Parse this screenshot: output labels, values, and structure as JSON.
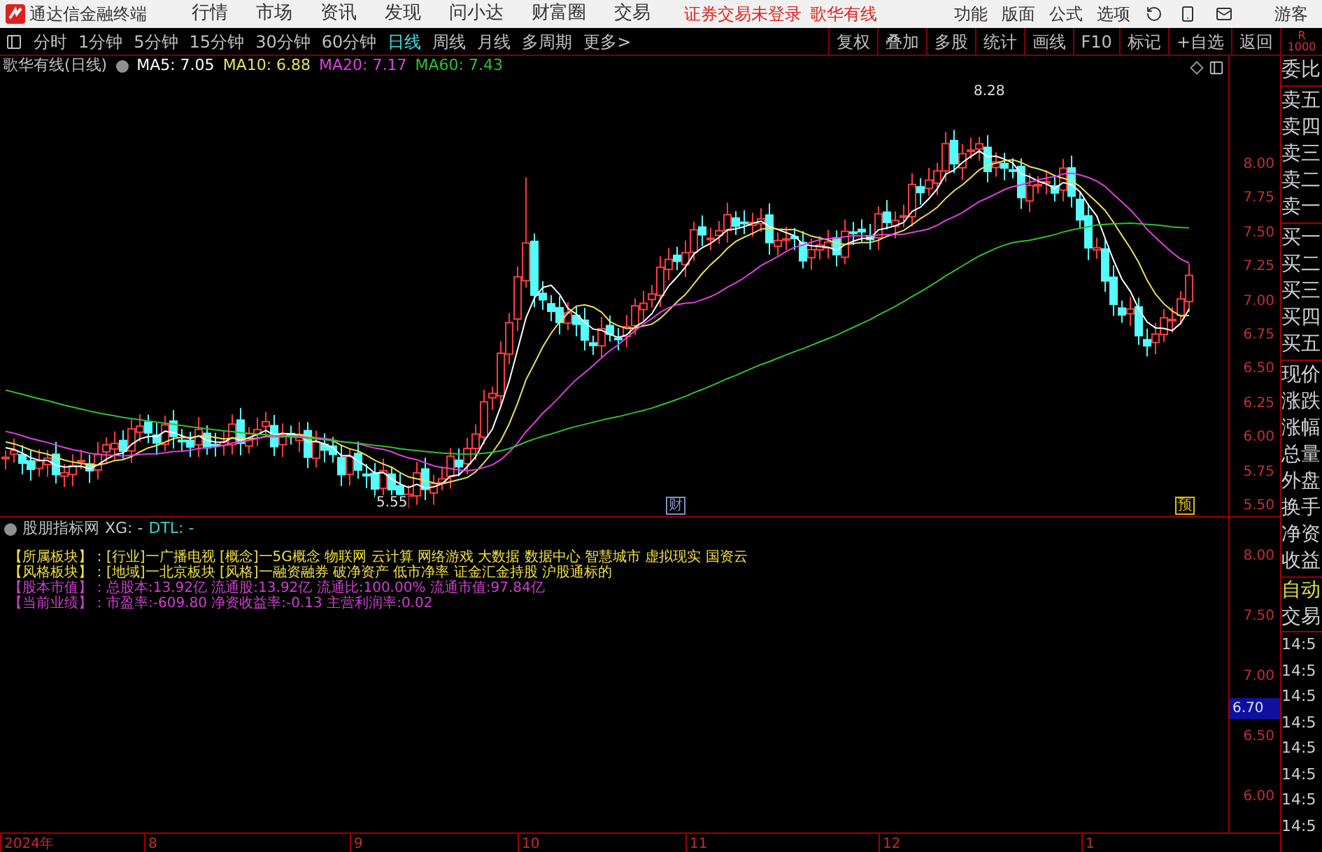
{
  "app": {
    "title": "通达信金融终端",
    "menu": [
      "行情",
      "市场",
      "资讯",
      "发现",
      "问小达",
      "财富圈",
      "交易"
    ],
    "login_status": "证券交易未登录",
    "stock": "歌华有线",
    "tools": [
      "功能",
      "版面",
      "公式",
      "选项"
    ],
    "user": "游客"
  },
  "period_bar": {
    "periods": [
      {
        "label": "分时",
        "selected": false
      },
      {
        "label": "1分钟",
        "selected": false
      },
      {
        "label": "5分钟",
        "selected": false
      },
      {
        "label": "15分钟",
        "selected": false
      },
      {
        "label": "30分钟",
        "selected": false
      },
      {
        "label": "60分钟",
        "selected": false
      },
      {
        "label": "日线",
        "selected": true
      },
      {
        "label": "周线",
        "selected": false
      },
      {
        "label": "月线",
        "selected": false
      },
      {
        "label": "多周期",
        "selected": false
      },
      {
        "label": "更多>",
        "selected": false
      }
    ],
    "actions": [
      "复权",
      "叠加",
      "多股",
      "统计",
      "画线",
      "F10",
      "标记",
      "+自选",
      "返回"
    ],
    "badge": [
      "R",
      "1000"
    ]
  },
  "chart": {
    "title": "歌华有线(日线)",
    "indicators": [
      {
        "label": "MA5: 7.05",
        "color": "#ffffff"
      },
      {
        "label": "MA10: 6.88",
        "color": "#e8e05a"
      },
      {
        "label": "MA20: 7.17",
        "color": "#e040e0"
      },
      {
        "label": "MA60: 7.43",
        "color": "#30c030"
      }
    ],
    "high_label": "8.28",
    "low_label": "5.55",
    "markers": [
      {
        "label": "财",
        "color": "#8090c0"
      },
      {
        "label": "预",
        "color": "#e0c000"
      }
    ],
    "price_axis": [
      "8.00",
      "7.75",
      "7.50",
      "7.25",
      "7.00",
      "6.75",
      "6.50",
      "6.25",
      "6.00",
      "5.75",
      "5.50"
    ]
  },
  "indicator_panel": {
    "title": "股朋指标网",
    "fields": [
      {
        "label": "XG: -",
        "color": "#c8c8c8"
      },
      {
        "label": "DTL: -",
        "color": "#40d0d0"
      }
    ],
    "info_rows": [
      {
        "label": "【所属板块】：",
        "value": "[行业]一广播电视 [概念]一5G概念 物联网 云计算 网络游戏 大数据 数据中心 智慧城市 虚拟现实 国资云",
        "color": "#f0e040"
      },
      {
        "label": "【风格板块】：",
        "value": "[地域]一北京板块 [风格]一融资融券 破净资产 低市净率 证金汇金持股 沪股通标的",
        "color": "#f0e040"
      },
      {
        "label": "【股本市值】：",
        "value": "总股本:13.92亿 流通股:13.92亿 流通比:100.00% 流通市值:97.84亿",
        "color": "#d040d0"
      },
      {
        "label": "【当前业绩】：",
        "value": "市盈率:-609.80 净资收益率:-0.13 主营利润率:0.02",
        "color": "#d040d0"
      }
    ],
    "price_axis": [
      "8.00",
      "7.50",
      "7.00",
      "6.50",
      "6.00"
    ],
    "current_price": "6.70"
  },
  "quote_panel": {
    "groups": [
      [
        "委比"
      ],
      [
        "卖五",
        "卖四",
        "卖三",
        "卖二",
        "卖一"
      ],
      [
        "买一",
        "买二",
        "买三",
        "买四",
        "买五"
      ],
      [
        "现价",
        "涨跌",
        "涨幅",
        "总量",
        "外盘",
        "换手",
        "净资",
        "收益"
      ]
    ],
    "mode": "自动",
    "trade": "交易",
    "times": [
      "14:5",
      "14:5",
      "14:5",
      "14:5",
      "14:5",
      "14:5",
      "14:5",
      "14:5"
    ]
  },
  "date_axis": [
    "2024年",
    "8",
    "9",
    "10",
    "11",
    "12",
    "1"
  ]
}
